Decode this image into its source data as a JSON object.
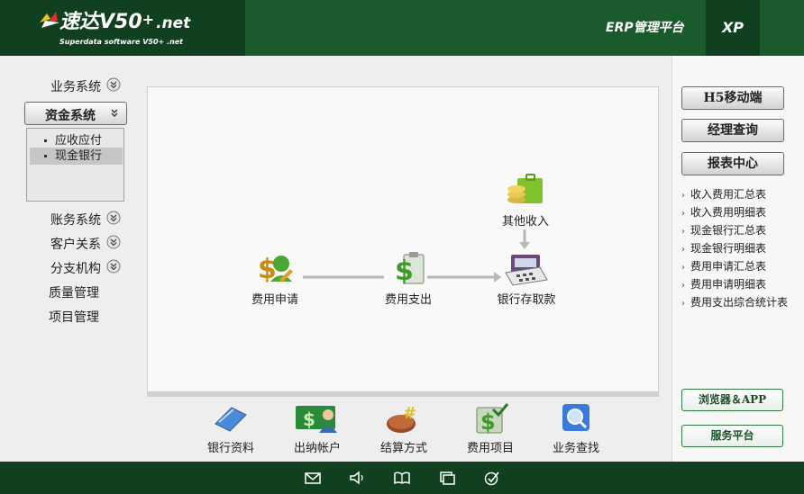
{
  "header": {
    "logo_title": "速达V50",
    "logo_sup": "+",
    "logo_suffix": ".net",
    "logo_sub": "Superdata software V50+ .net",
    "platform": "ERP管理平台",
    "edition": "XP"
  },
  "left_nav": {
    "items": [
      {
        "label": "业务系统",
        "expandable": true
      },
      {
        "label": "资金系统",
        "expandable": true,
        "active": true
      },
      {
        "label": "账务系统",
        "expandable": true
      },
      {
        "label": "客户关系",
        "expandable": true
      },
      {
        "label": "分支机构",
        "expandable": true
      },
      {
        "label": "质量管理",
        "expandable": false
      },
      {
        "label": "项目管理",
        "expandable": false
      }
    ],
    "submenu": [
      {
        "label": "应收应付"
      },
      {
        "label": "现金银行",
        "selected": true
      }
    ]
  },
  "flow": {
    "nodes": [
      {
        "label": "费用申请",
        "icon": "expense-request-icon"
      },
      {
        "label": "费用支出",
        "icon": "expense-payment-icon"
      },
      {
        "label": "银行存取款",
        "icon": "bank-deposit-icon"
      },
      {
        "label": "其他收入",
        "icon": "other-income-icon"
      }
    ]
  },
  "bottom_tools": [
    {
      "label": "银行资料",
      "icon": "bank-info-icon"
    },
    {
      "label": "出纳帐户",
      "icon": "cashier-account-icon"
    },
    {
      "label": "结算方式",
      "icon": "settlement-method-icon"
    },
    {
      "label": "费用项目",
      "icon": "expense-item-icon"
    },
    {
      "label": "业务查找",
      "icon": "business-search-icon"
    }
  ],
  "right_panel": {
    "buttons": [
      "H5移动端",
      "经理查询",
      "报表中心"
    ],
    "reports": [
      "收入费用汇总表",
      "收入费用明细表",
      "现金银行汇总表",
      "现金银行明细表",
      "费用申请汇总表",
      "费用申请明细表",
      "费用支出综合统计表"
    ],
    "bottom_buttons": [
      "浏览器＆APP",
      "服务平台"
    ]
  },
  "footer_icons": [
    "mail-icon",
    "speaker-icon",
    "book-icon",
    "window-icon",
    "check-icon"
  ],
  "colors": {
    "header_green": "#1a5a2c",
    "dark_green": "#114020",
    "accent_green": "#2e7a3e"
  }
}
